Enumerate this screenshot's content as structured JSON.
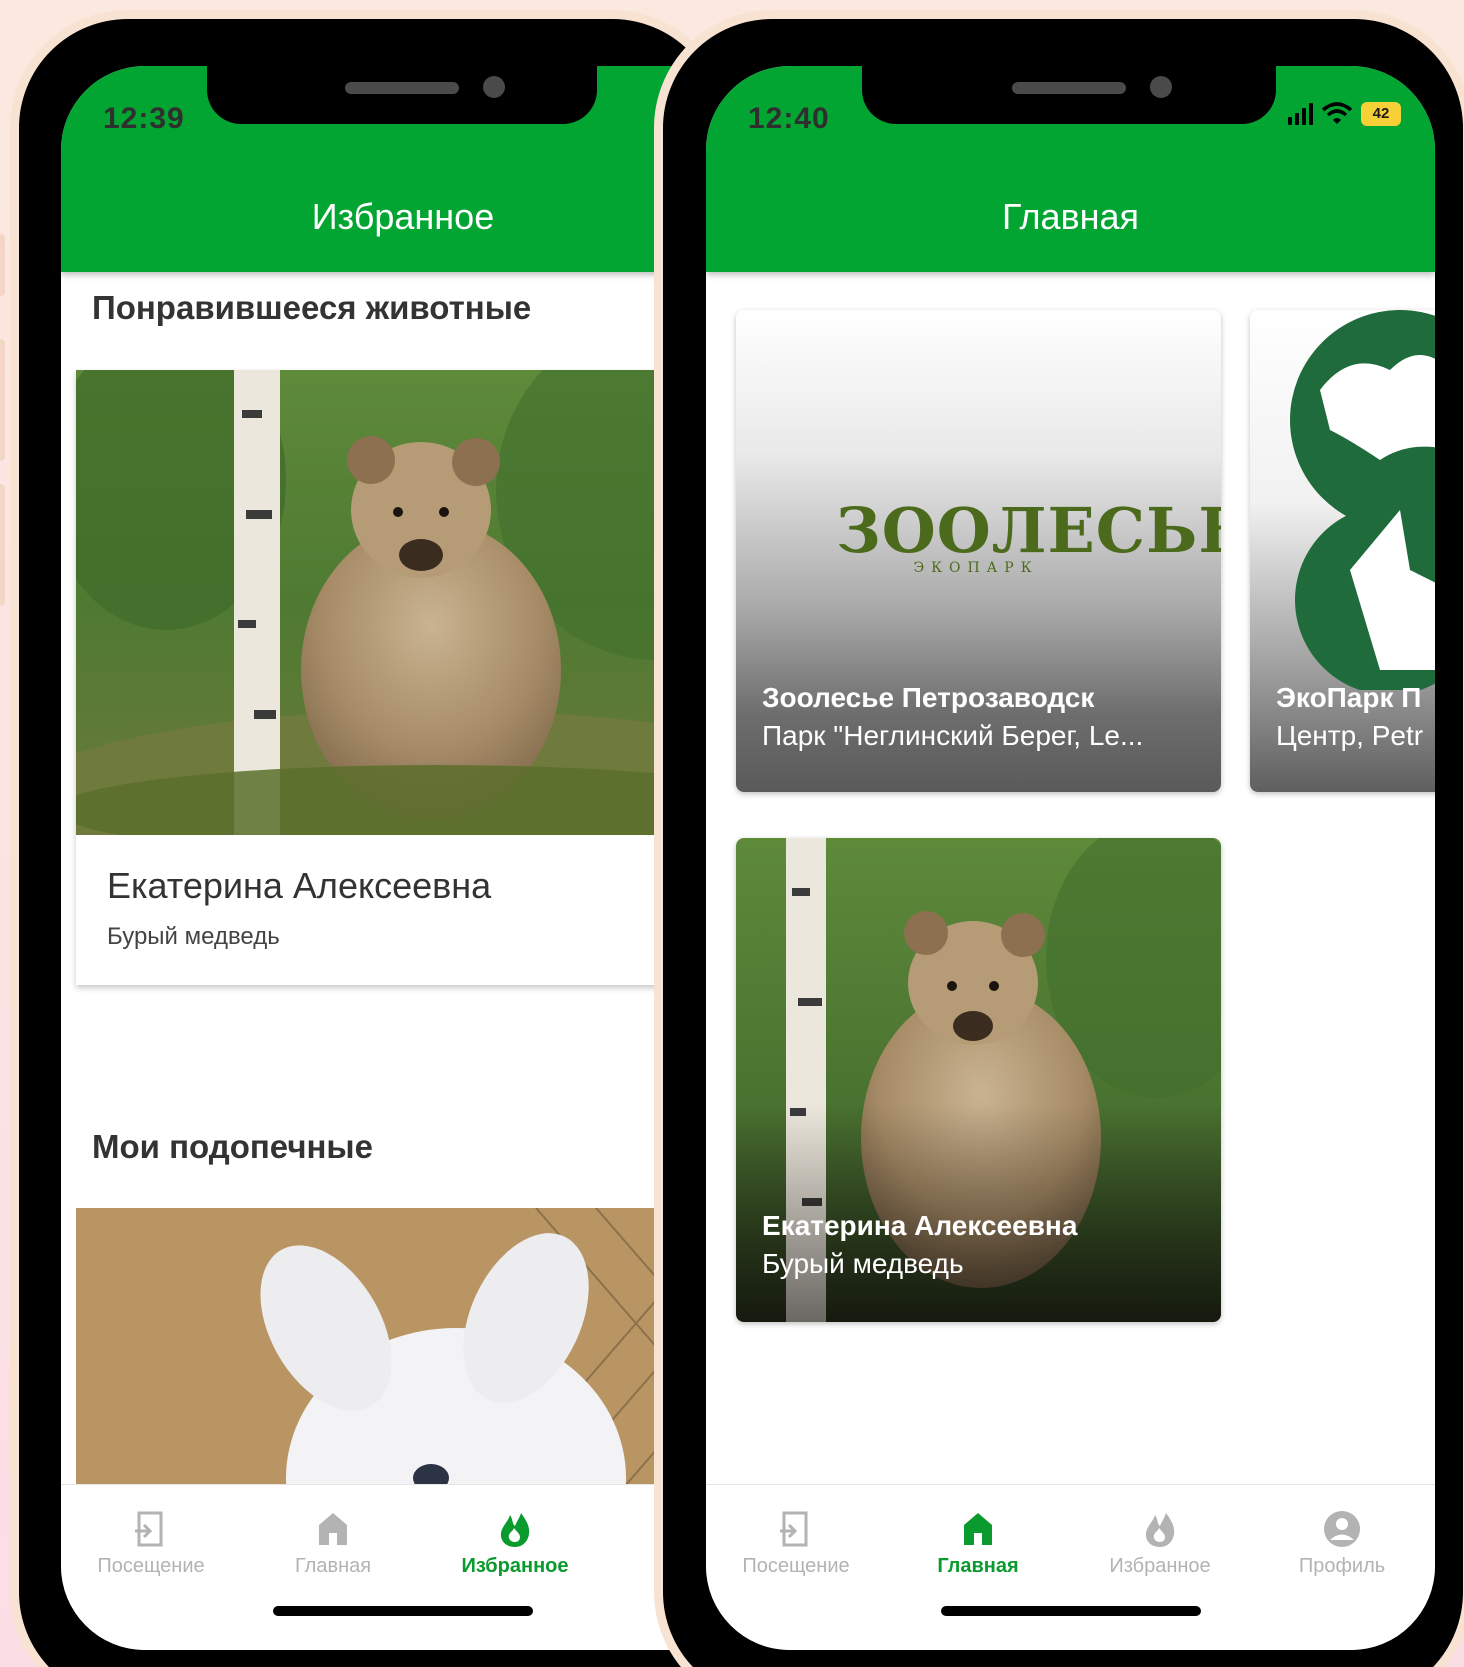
{
  "left_screen": {
    "status_time": "12:39",
    "app_title": "Избранное",
    "liked_section_title": "Понравившееся животные",
    "liked_animal": {
      "name": "Екатерина Алексеевна",
      "species": "Бурый медведь"
    },
    "wards_section_title": "Мои подопечные",
    "nav": [
      {
        "label": "Посещение",
        "icon": "checkin-icon",
        "active": false
      },
      {
        "label": "Главная",
        "icon": "home-icon",
        "active": false
      },
      {
        "label": "Избранное",
        "icon": "flame-icon",
        "active": true
      }
    ]
  },
  "right_screen": {
    "status_time": "12:40",
    "battery": "42",
    "app_title": "Главная",
    "parks": [
      {
        "title": "Зоолесье Петрозаводск",
        "subtitle": "Парк \"Неглинский Берег, Le...",
        "logo_main": "ЗООЛЕСЬЕ",
        "logo_sub": "ЭКОПАРК"
      },
      {
        "title": "ЭкоПарк П",
        "subtitle": "Центр, Petr"
      }
    ],
    "animal": {
      "name": "Екатерина Алексеевна",
      "species": "Бурый медведь"
    },
    "nav": [
      {
        "label": "Посещение",
        "icon": "checkin-icon",
        "active": false
      },
      {
        "label": "Главная",
        "icon": "home-icon",
        "active": true
      },
      {
        "label": "Избранное",
        "icon": "flame-icon",
        "active": false
      },
      {
        "label": "Профиль",
        "icon": "profile-icon",
        "active": false
      }
    ]
  },
  "colors": {
    "brand_green": "#03a532",
    "active_nav": "#0b9a2e",
    "inactive_nav": "#b3b3b3",
    "logo_green": "#4b6a1c",
    "eco_green": "#1f6b3c"
  }
}
